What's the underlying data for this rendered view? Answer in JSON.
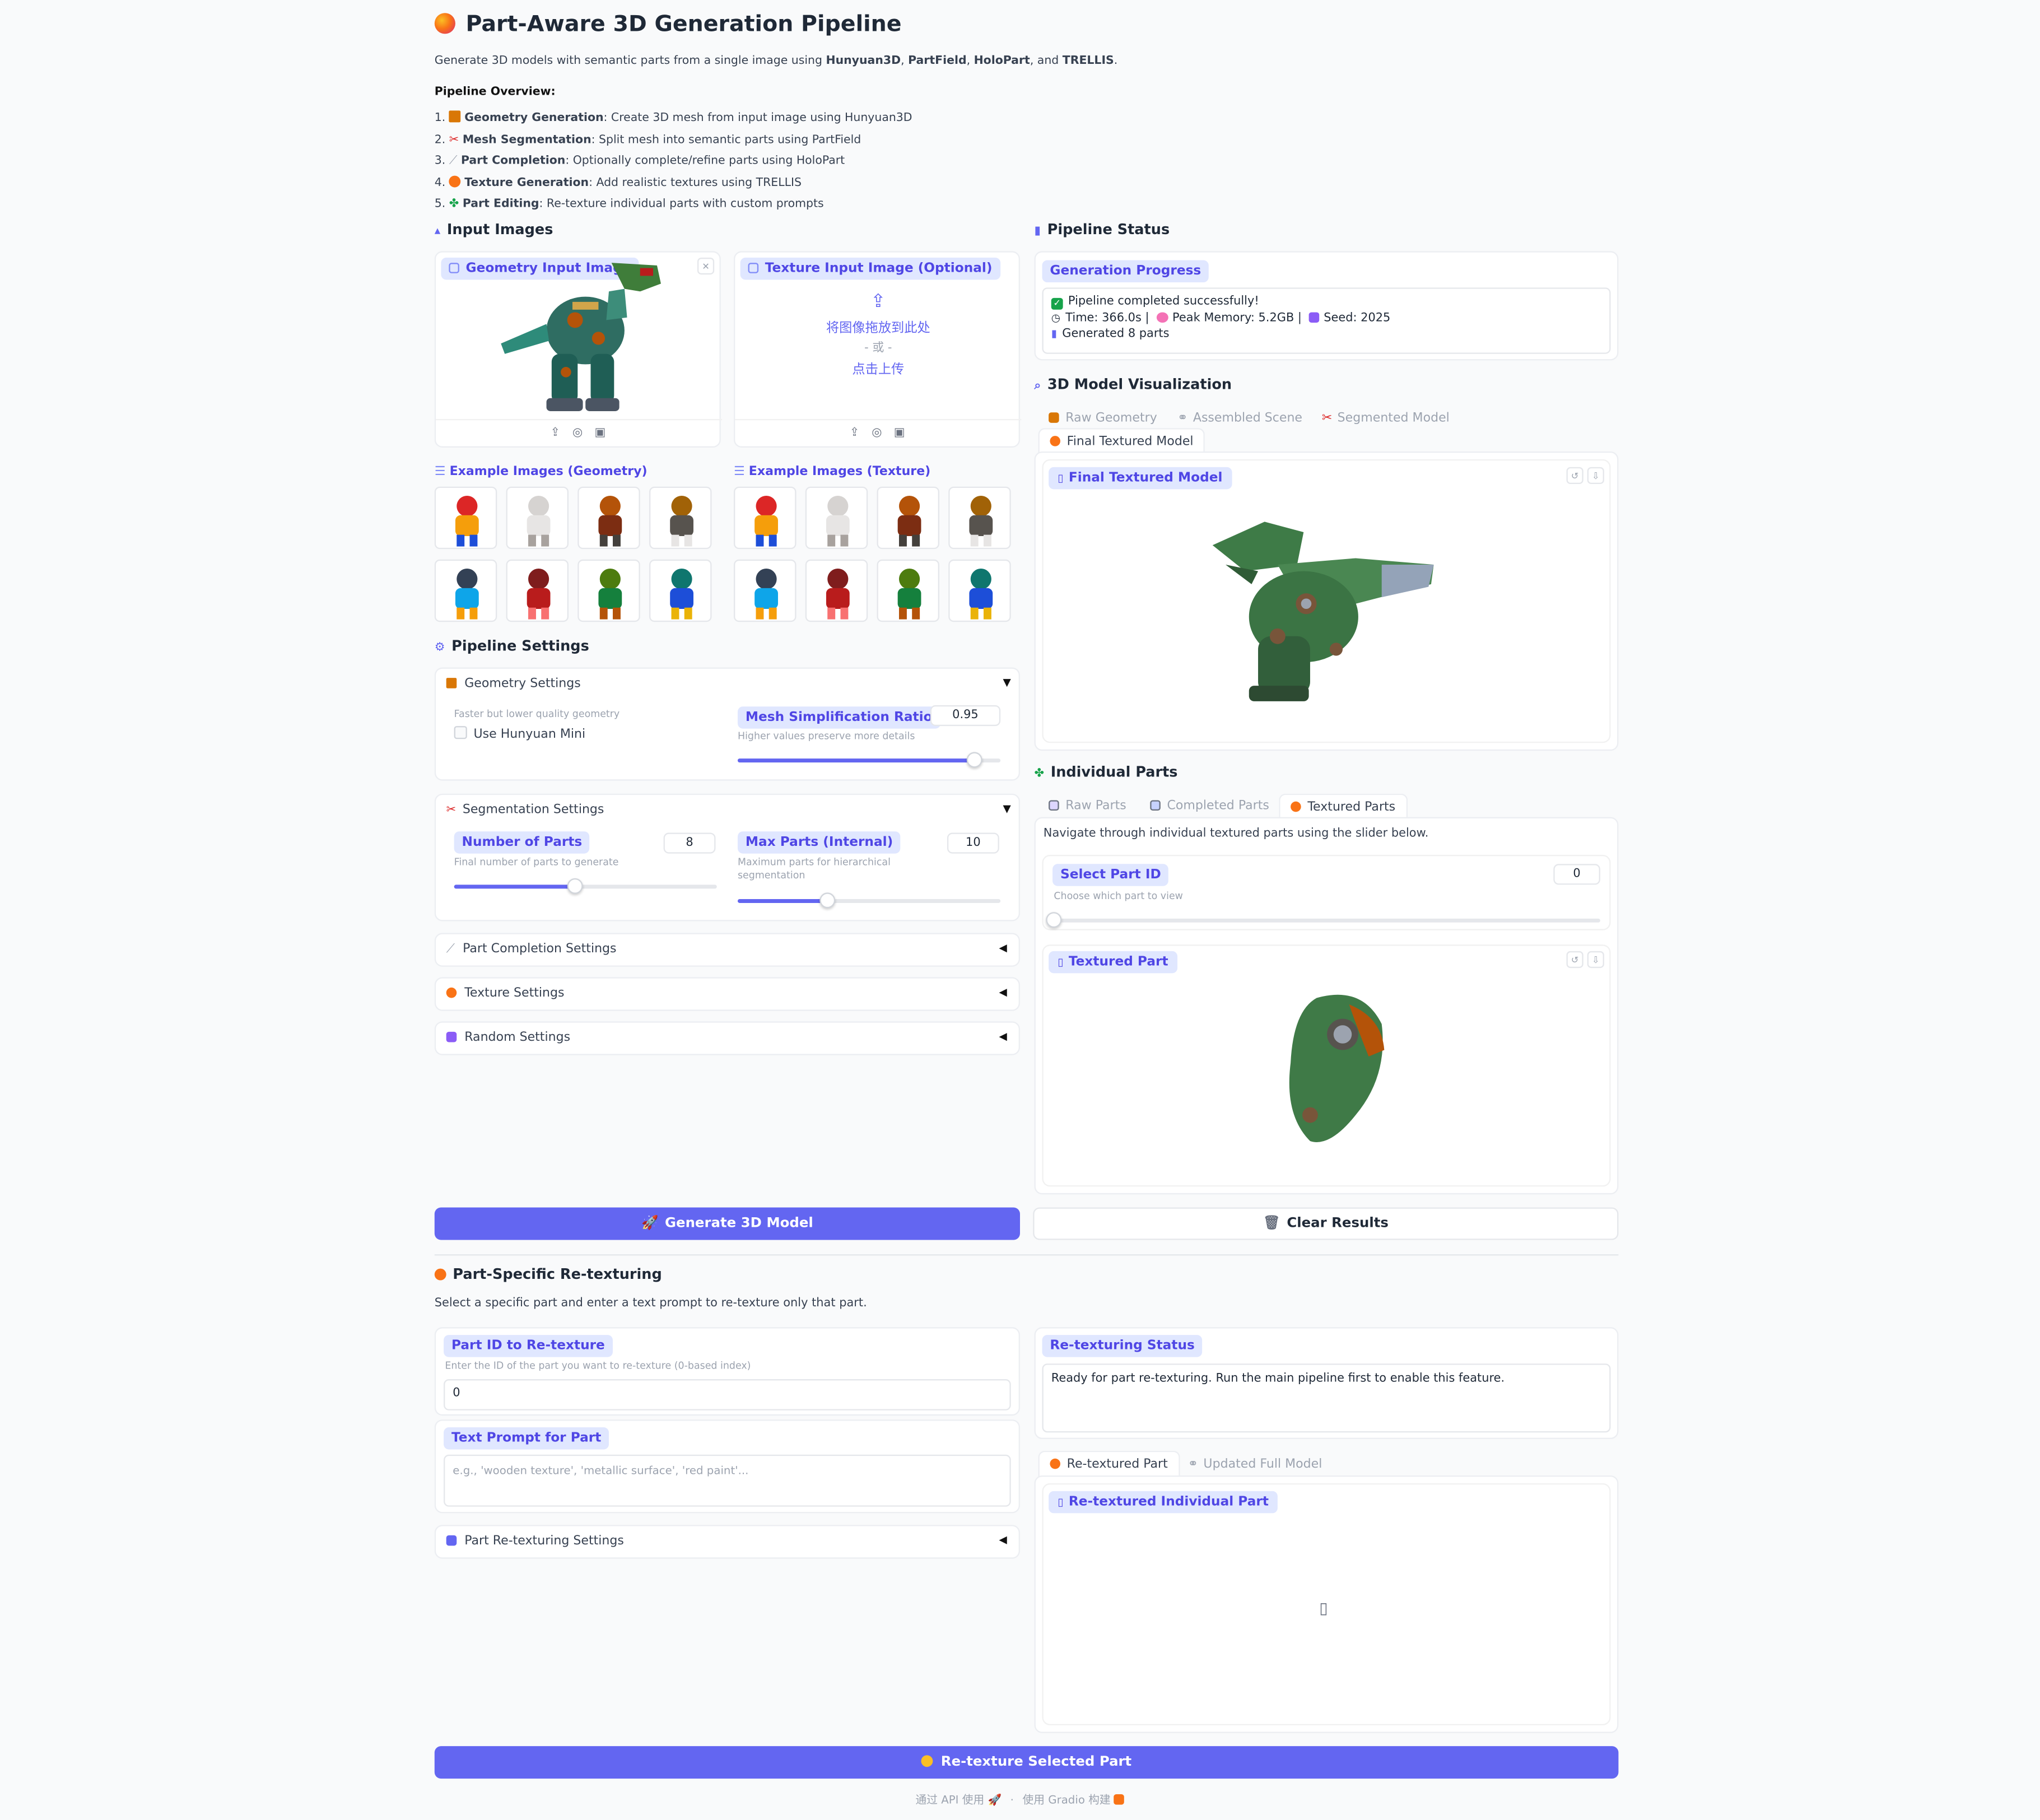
{
  "header": {
    "title": "Part-Aware 3D Generation Pipeline",
    "intro_prefix": "Generate 3D models with semantic parts from a single image using ",
    "intro_t1": "Hunyuan3D",
    "intro_sep1": ", ",
    "intro_t2": "PartField",
    "intro_sep2": ", ",
    "intro_t3": "HoloPart",
    "intro_sep3": ", and ",
    "intro_t4": "TRELLIS",
    "intro_end": ".",
    "overview_title": "Pipeline Overview:",
    "steps": [
      {
        "num": "1.",
        "name": "Geometry Generation",
        "desc": ": Create 3D mesh from input image using Hunyuan3D"
      },
      {
        "num": "2.",
        "name": "Mesh Segmentation",
        "desc": ": Split mesh into semantic parts using PartField"
      },
      {
        "num": "3.",
        "name": "Part Completion",
        "desc": ": Optionally complete/refine parts using HoloPart"
      },
      {
        "num": "4.",
        "name": "Texture Generation",
        "desc": ": Add realistic textures using TRELLIS"
      },
      {
        "num": "5.",
        "name": "Part Editing",
        "desc": ": Re-texture individual parts with custom prompts"
      }
    ]
  },
  "input_images": {
    "heading": "Input Images",
    "geometry_label": "Geometry Input Image",
    "texture_label": "Texture Input Image (Optional)",
    "drop_text": "将图像拖放到此处",
    "or_text": "- 或 -",
    "click_text": "点击上传",
    "examples_geometry": "Example Images (Geometry)",
    "examples_texture": "Example Images (Texture)"
  },
  "pipeline_settings": {
    "heading": "Pipeline Settings",
    "geometry": {
      "title": "Geometry Settings",
      "mini_info": "Faster but lower quality geometry",
      "mini_label": "Use Hunyuan Mini",
      "ratio_label": "Mesh Simplification Ratio",
      "ratio_info": "Higher values preserve more details",
      "ratio_value": "0.95",
      "ratio_fraction": 0.9
    },
    "segmentation": {
      "title": "Segmentation Settings",
      "parts_label": "Number of Parts",
      "parts_info": "Final number of parts to generate",
      "parts_value": "8",
      "parts_fraction": 0.46,
      "max_label": "Max Parts (Internal)",
      "max_info_1": "Maximum parts for hierarchical",
      "max_info_2": "segmentation",
      "max_value": "10",
      "max_fraction": 0.34
    },
    "completion_title": "Part Completion Settings",
    "texture_title": "Texture Settings",
    "random_title": "Random Settings"
  },
  "status": {
    "heading": "Pipeline Status",
    "progress_label": "Generation Progress",
    "line1": "Pipeline completed successfully!",
    "line2a": "Time: 366.0s |",
    "line2b": "Peak Memory: 5.2GB |",
    "line2c": "Seed: 2025",
    "line3": "Generated 8 parts"
  },
  "viz": {
    "heading": "3D Model Visualization",
    "tabs": [
      "Raw Geometry",
      "Assembled Scene",
      "Segmented Model",
      "Final Textured Model"
    ],
    "model_label": "Final Textured Model"
  },
  "parts": {
    "heading": "Individual Parts",
    "tabs": [
      "Raw Parts",
      "Completed Parts",
      "Textured Parts"
    ],
    "desc": "Navigate through individual textured parts using the slider below.",
    "select_label": "Select Part ID",
    "select_info": "Choose which part to view",
    "select_value": "0",
    "select_fraction": 0,
    "part_label": "Textured Part"
  },
  "actions": {
    "generate": "Generate 3D Model",
    "clear": "Clear Results"
  },
  "retexture": {
    "heading": "Part-Specific Re-texturing",
    "desc": "Select a specific part and enter a text prompt to re-texture only that part.",
    "id_label": "Part ID to Re-texture",
    "id_info": "Enter the ID of the part you want to re-texture (0-based index)",
    "id_value": "0",
    "prompt_label": "Text Prompt for Part",
    "prompt_placeholder": "e.g., 'wooden texture', 'metallic surface', 'red paint'...",
    "settings_title": "Part Re-texturing Settings",
    "status_label": "Re-texturing Status",
    "status_text": "Ready for part re-texturing. Run the main pipeline first to enable this feature.",
    "tabs": [
      "Re-textured Part",
      "Updated Full Model"
    ],
    "result_label": "Re-textured Individual Part",
    "button": "Re-texture Selected Part"
  },
  "footer": {
    "api": "通过 API 使用",
    "sep": "·",
    "built": "使用 Gradio 构建"
  },
  "colors": {
    "accent": "#6366f1",
    "label_bg": "#e0e7ff",
    "label_text": "#4f46e5"
  }
}
